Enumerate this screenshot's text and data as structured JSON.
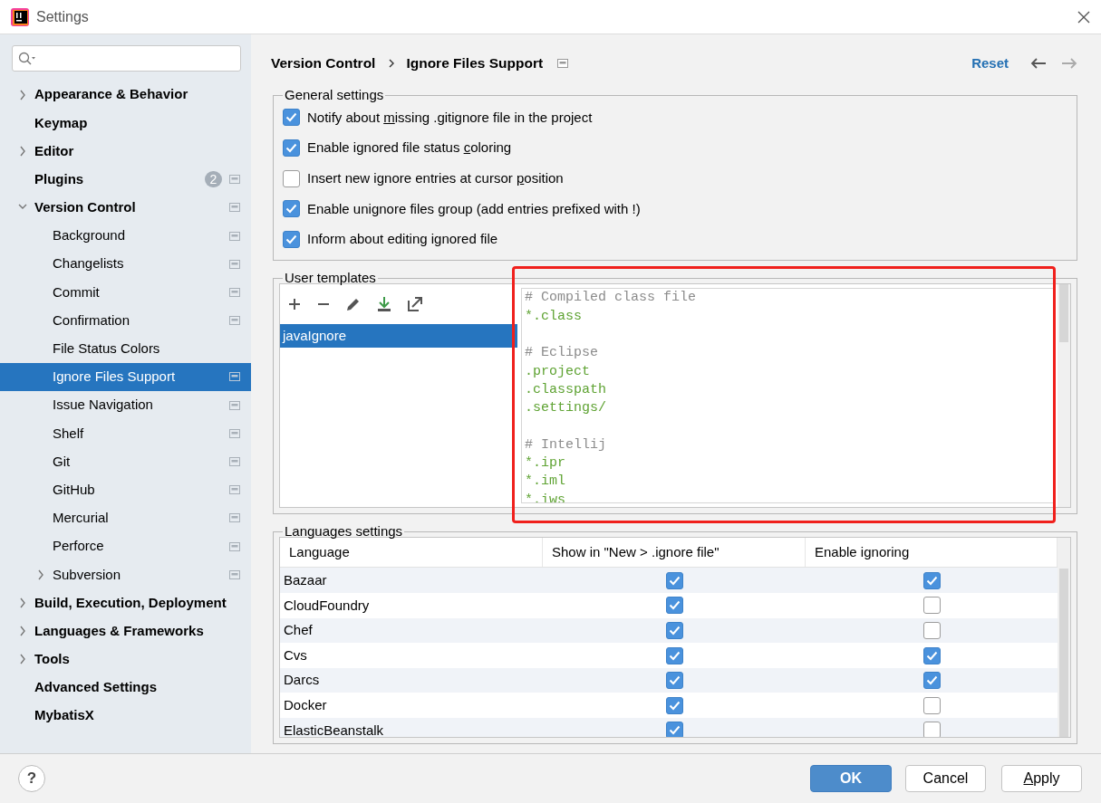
{
  "window": {
    "title": "Settings"
  },
  "sidebar": {
    "items": [
      {
        "label": "Appearance & Behavior",
        "expandable": true,
        "expanded": false,
        "selected": false,
        "project_level": false
      },
      {
        "label": "Keymap",
        "expandable": false,
        "selected": false,
        "project_level": false
      },
      {
        "label": "Editor",
        "expandable": true,
        "expanded": false,
        "selected": false,
        "project_level": false
      },
      {
        "label": "Plugins",
        "expandable": false,
        "selected": false,
        "project_level": true,
        "badge": "2"
      },
      {
        "label": "Version Control",
        "expandable": true,
        "expanded": true,
        "selected": false,
        "project_level": true,
        "children": [
          {
            "label": "Background",
            "expandable": false,
            "selected": false,
            "project_level": true
          },
          {
            "label": "Changelists",
            "expandable": false,
            "selected": false,
            "project_level": true
          },
          {
            "label": "Commit",
            "expandable": false,
            "selected": false,
            "project_level": true
          },
          {
            "label": "Confirmation",
            "expandable": false,
            "selected": false,
            "project_level": true
          },
          {
            "label": "File Status Colors",
            "expandable": false,
            "selected": false,
            "project_level": false
          },
          {
            "label": "Ignore Files Support",
            "expandable": false,
            "selected": true,
            "project_level": true
          },
          {
            "label": "Issue Navigation",
            "expandable": false,
            "selected": false,
            "project_level": true
          },
          {
            "label": "Shelf",
            "expandable": false,
            "selected": false,
            "project_level": true
          },
          {
            "label": "Git",
            "expandable": false,
            "selected": false,
            "project_level": true
          },
          {
            "label": "GitHub",
            "expandable": false,
            "selected": false,
            "project_level": true
          },
          {
            "label": "Mercurial",
            "expandable": false,
            "selected": false,
            "project_level": true
          },
          {
            "label": "Perforce",
            "expandable": false,
            "selected": false,
            "project_level": true
          },
          {
            "label": "Subversion",
            "expandable": true,
            "expanded": false,
            "selected": false,
            "project_level": true
          }
        ]
      },
      {
        "label": "Build, Execution, Deployment",
        "expandable": true,
        "expanded": false,
        "selected": false,
        "project_level": false
      },
      {
        "label": "Languages & Frameworks",
        "expandable": true,
        "expanded": false,
        "selected": false,
        "project_level": false
      },
      {
        "label": "Tools",
        "expandable": true,
        "expanded": false,
        "selected": false,
        "project_level": false
      },
      {
        "label": "Advanced Settings",
        "expandable": false,
        "selected": false,
        "project_level": false
      },
      {
        "label": "MybatisX",
        "expandable": false,
        "selected": false,
        "project_level": false
      }
    ]
  },
  "header": {
    "breadcrumb": [
      "Version Control",
      "Ignore Files Support"
    ],
    "reset": "Reset"
  },
  "general_settings": {
    "title": "General settings",
    "options": [
      {
        "label_start": "Notify about ",
        "mnemonic": "m",
        "label_end": "issing .gitignore file in the project",
        "checked": true
      },
      {
        "label_start": "Enable ignored file status ",
        "mnemonic": "c",
        "label_end": "oloring",
        "checked": true
      },
      {
        "label_start": "Insert new ignore entries at cursor ",
        "mnemonic": "p",
        "label_end": "osition",
        "checked": false
      },
      {
        "label_start": "Enable unignore files group (add entries prefixed with !)",
        "checked": true
      },
      {
        "label_start": "Inform about editing ignored file",
        "checked": true
      }
    ]
  },
  "user_templates": {
    "title": "User templates",
    "templates": [
      {
        "name": "javaIgnore",
        "selected": true
      }
    ],
    "editor_lines": [
      {
        "kind": "comment",
        "text": "# Compiled class file"
      },
      {
        "kind": "pattern",
        "text": "*.class"
      },
      {
        "kind": "blank"
      },
      {
        "kind": "comment",
        "text": "# Eclipse"
      },
      {
        "kind": "pattern",
        "text": ".project"
      },
      {
        "kind": "pattern",
        "text": ".classpath"
      },
      {
        "kind": "pattern",
        "text": ".settings/"
      },
      {
        "kind": "blank"
      },
      {
        "kind": "comment",
        "text": "# Intellij"
      },
      {
        "kind": "pattern",
        "text": "*.ipr"
      },
      {
        "kind": "pattern",
        "text": "*.iml"
      },
      {
        "kind": "pattern",
        "text": "*.iws"
      }
    ]
  },
  "languages": {
    "title": "Languages settings",
    "columns": [
      "Language",
      "Show in \"New > .ignore file\"",
      "Enable ignoring"
    ],
    "rows": [
      {
        "name": "Bazaar",
        "show_in_new": true,
        "enable_ignoring": true
      },
      {
        "name": "CloudFoundry",
        "show_in_new": true,
        "enable_ignoring": false
      },
      {
        "name": "Chef",
        "show_in_new": true,
        "enable_ignoring": false
      },
      {
        "name": "Cvs",
        "show_in_new": true,
        "enable_ignoring": true
      },
      {
        "name": "Darcs",
        "show_in_new": true,
        "enable_ignoring": true
      },
      {
        "name": "Docker",
        "show_in_new": true,
        "enable_ignoring": false
      },
      {
        "name": "ElasticBeanstalk",
        "show_in_new": true,
        "enable_ignoring": false
      }
    ]
  },
  "footer": {
    "help": "?",
    "buttons": [
      {
        "kind": "primary",
        "label_start": "OK"
      },
      {
        "kind": "secondary",
        "label_start": "Cancel"
      },
      {
        "kind": "secondary",
        "mnemonic": "A",
        "label_end": "pply"
      }
    ]
  }
}
